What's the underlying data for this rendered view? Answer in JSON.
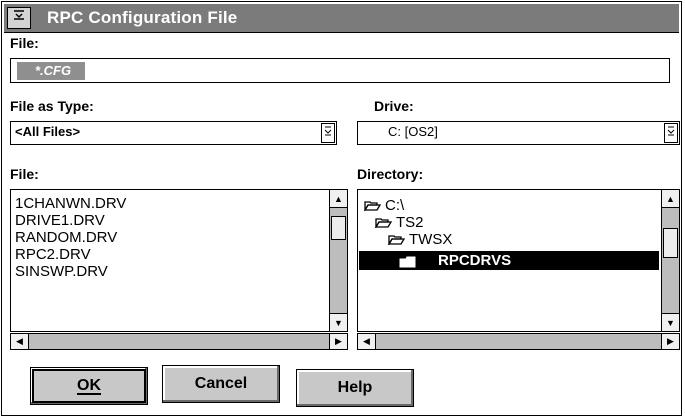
{
  "window": {
    "title": "RPC Configuration  File"
  },
  "system_menu": {
    "glyph": "≡"
  },
  "file_field": {
    "label": "File:",
    "value": "*.CFG"
  },
  "file_type": {
    "label": "File as Type:",
    "selected": "<All Files>"
  },
  "drive": {
    "label": "Drive:",
    "selected": "C:  [OS2]"
  },
  "file_list": {
    "label": "File:",
    "items": [
      "1CHANWN.DRV",
      "DRIVE1.DRV",
      "RANDOM.DRV",
      "RPC2.DRV",
      "SINSWP.DRV"
    ]
  },
  "directory_list": {
    "label": "Directory:",
    "items": [
      "C:\\",
      "TS2",
      "TWSX",
      "RPCDRVS"
    ]
  },
  "buttons": {
    "ok": "OK",
    "cancel": "Cancel",
    "help": "Help"
  },
  "icons": {
    "scroll_up": "▲",
    "scroll_down": "▼",
    "scroll_left": "◀",
    "scroll_right": "▶",
    "dropdown": "chevron-down-icon",
    "folder_open": "open-folder-icon",
    "folder_closed": "folder-icon"
  },
  "colors": {
    "titlebar": "#7b7b7b",
    "selection": "#000000",
    "field_selection": "#8f8f8f"
  }
}
